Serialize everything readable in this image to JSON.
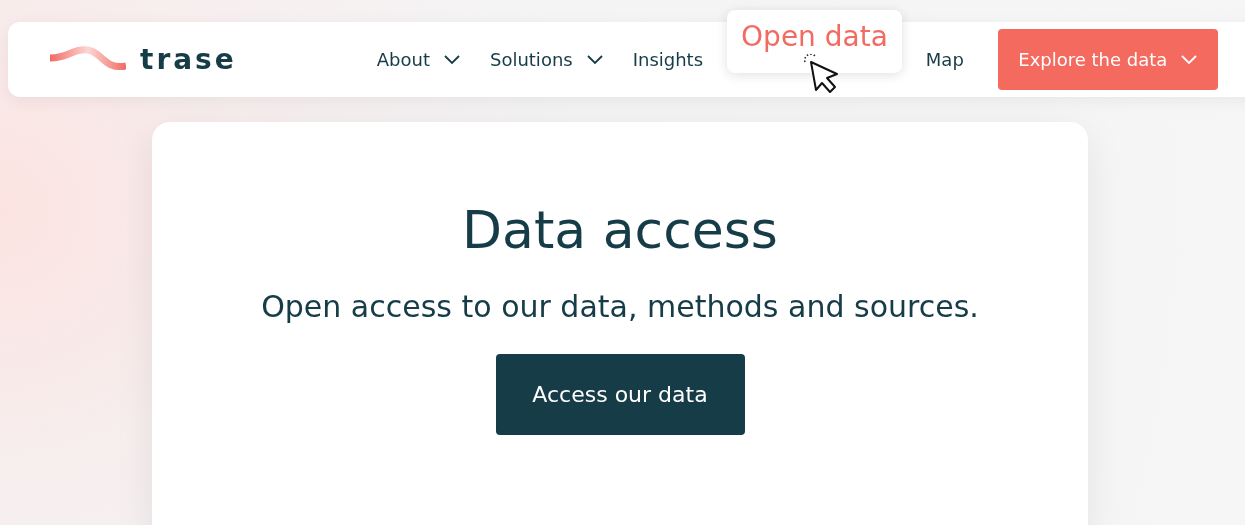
{
  "header": {
    "logo": {
      "text": "trase"
    },
    "nav": [
      {
        "label": "About",
        "kind": "dropdown",
        "selected": false
      },
      {
        "label": "Solutions",
        "kind": "dropdown",
        "selected": false
      },
      {
        "label": "Insights",
        "kind": "link",
        "selected": false
      },
      {
        "label": "Open data",
        "kind": "link",
        "selected": true
      },
      {
        "label": "Map",
        "kind": "link",
        "selected": false
      }
    ],
    "cta": {
      "label": "Explore the data"
    }
  },
  "card": {
    "title": "Data access",
    "subtitle": "Open access to our data, methods and sources.",
    "button": "Access our data"
  }
}
